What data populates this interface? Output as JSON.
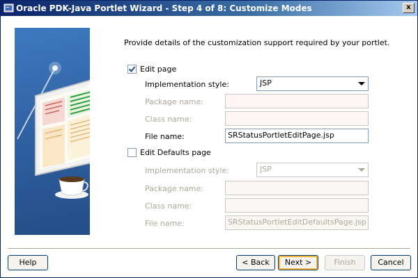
{
  "window": {
    "title": "Oracle PDK-Java Portlet Wizard - Step 4 of 8: Customize Modes",
    "close_glyph": "x"
  },
  "instructions": "Provide details of the customization support required by your portlet.",
  "edit_page": {
    "label": "Edit page",
    "checked": true,
    "impl_label": "Implementation style:",
    "impl_value": "JSP",
    "package_label": "Package name:",
    "package_value": "",
    "class_label": "Class name:",
    "class_value": "",
    "file_label": "File name:",
    "file_value": "SRStatusPortletEditPage.jsp"
  },
  "edit_defaults_page": {
    "label": "Edit Defaults page",
    "checked": false,
    "impl_label": "Implementation style:",
    "impl_value": "JSP",
    "package_label": "Package name:",
    "package_value": "",
    "class_label": "Class name:",
    "class_value": "",
    "file_label": "File name:",
    "file_value": "SRStatusPortletEditDefaultsPage.jsp"
  },
  "buttons": {
    "help": "Help",
    "back": "< Back",
    "next": "Next >",
    "finish": "Finish",
    "cancel": "Cancel"
  },
  "colors": {
    "title_bar": "#0a246a",
    "banner": "#2e5f9f",
    "checkmark": "#1c5180",
    "disabled_text": "#aca899"
  }
}
